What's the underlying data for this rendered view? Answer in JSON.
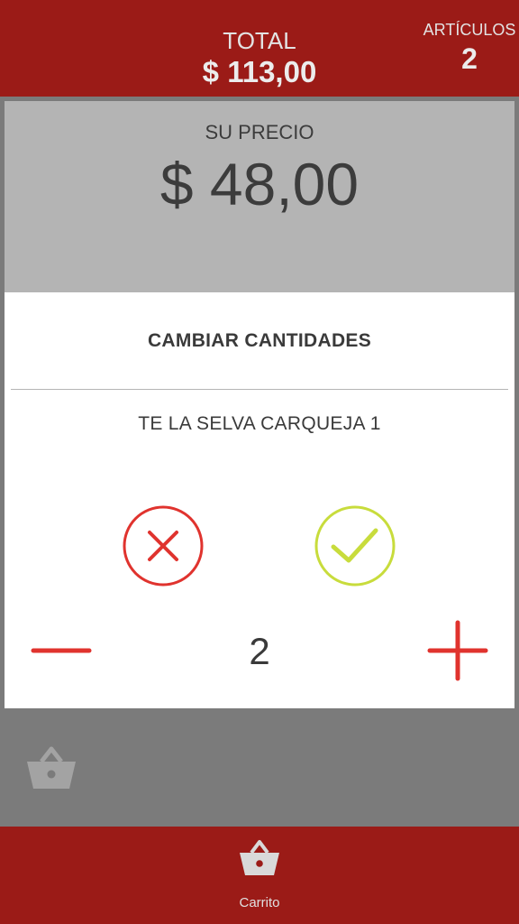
{
  "header": {
    "total_label": "TOTAL",
    "total_value": "$ 113,00",
    "articles_label": "ARTÍCULOS",
    "articles_count": "2"
  },
  "price_panel": {
    "label": "SU PRECIO",
    "value": "$ 48,00"
  },
  "modal": {
    "title": "CAMBIAR CANTIDADES",
    "product_name": "TE LA SELVA CARQUEJA 1",
    "quantity": "2",
    "cancel_icon": "close-icon",
    "confirm_icon": "check-icon",
    "minus_icon": "minus-icon",
    "plus_icon": "plus-icon"
  },
  "bottom_nav": {
    "cart_label": "Carrito",
    "cart_icon": "basket-icon"
  },
  "colors": {
    "brand_red": "#9b1b17",
    "accent_red": "#e0332e",
    "confirm_green": "#c8dc3c",
    "overlay_gray": "#7b7b7b"
  }
}
